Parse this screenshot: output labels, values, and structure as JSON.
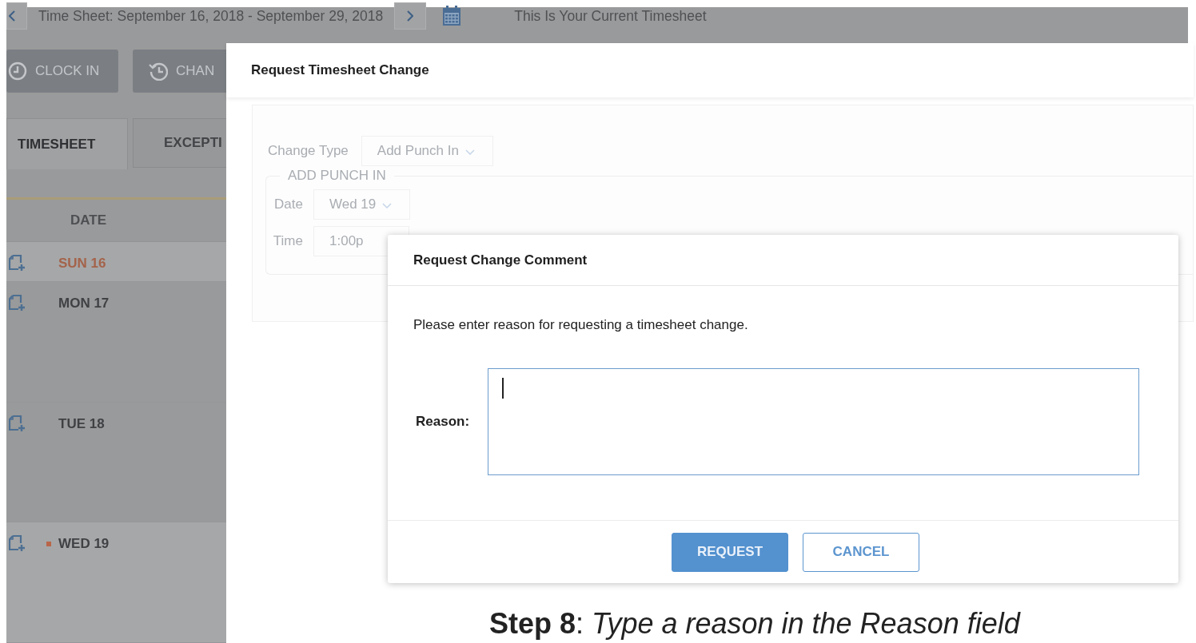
{
  "background": {
    "header": {
      "title": "Time Sheet: September 16, 2018 - September 29, 2018",
      "status": "This Is Your Current Timesheet"
    },
    "actions": [
      {
        "label": "CLOCK IN"
      },
      {
        "label": "CHAN"
      }
    ],
    "tabs": [
      {
        "label": "TIMESHEET",
        "selected": true
      },
      {
        "label": "EXCEPTI",
        "selected": false
      }
    ],
    "table": {
      "columns": [
        "DATE"
      ],
      "rows": [
        {
          "date": "SUN 16",
          "weekend": true,
          "flagged": false,
          "highlighted": true
        },
        {
          "date": "MON 17",
          "weekend": false,
          "flagged": false,
          "highlighted": false
        },
        {
          "date": "TUE 18",
          "weekend": false,
          "flagged": false,
          "highlighted": false
        },
        {
          "date": "WED 19",
          "weekend": false,
          "flagged": true,
          "highlighted": true
        }
      ]
    }
  },
  "change_dialog": {
    "title": "Request Timesheet Change",
    "change_type": {
      "label": "Change Type",
      "value": "Add Punch In"
    },
    "fieldset": {
      "legend": "ADD PUNCH IN",
      "fields": [
        {
          "label": "Date",
          "value": "Wed 19",
          "kind": "select"
        },
        {
          "label": "Time",
          "value": "1:00p",
          "kind": "text"
        }
      ]
    }
  },
  "comment_dialog": {
    "title": "Request Change Comment",
    "message": "Please enter reason for requesting a timesheet change.",
    "reason": {
      "label": "Reason:",
      "focused": true
    },
    "buttons": [
      {
        "label": "REQUEST",
        "primary": true
      },
      {
        "label": "CANCEL",
        "primary": false
      }
    ]
  },
  "caption": "**Step 8**:  *Type a reason in the Reason field*"
}
